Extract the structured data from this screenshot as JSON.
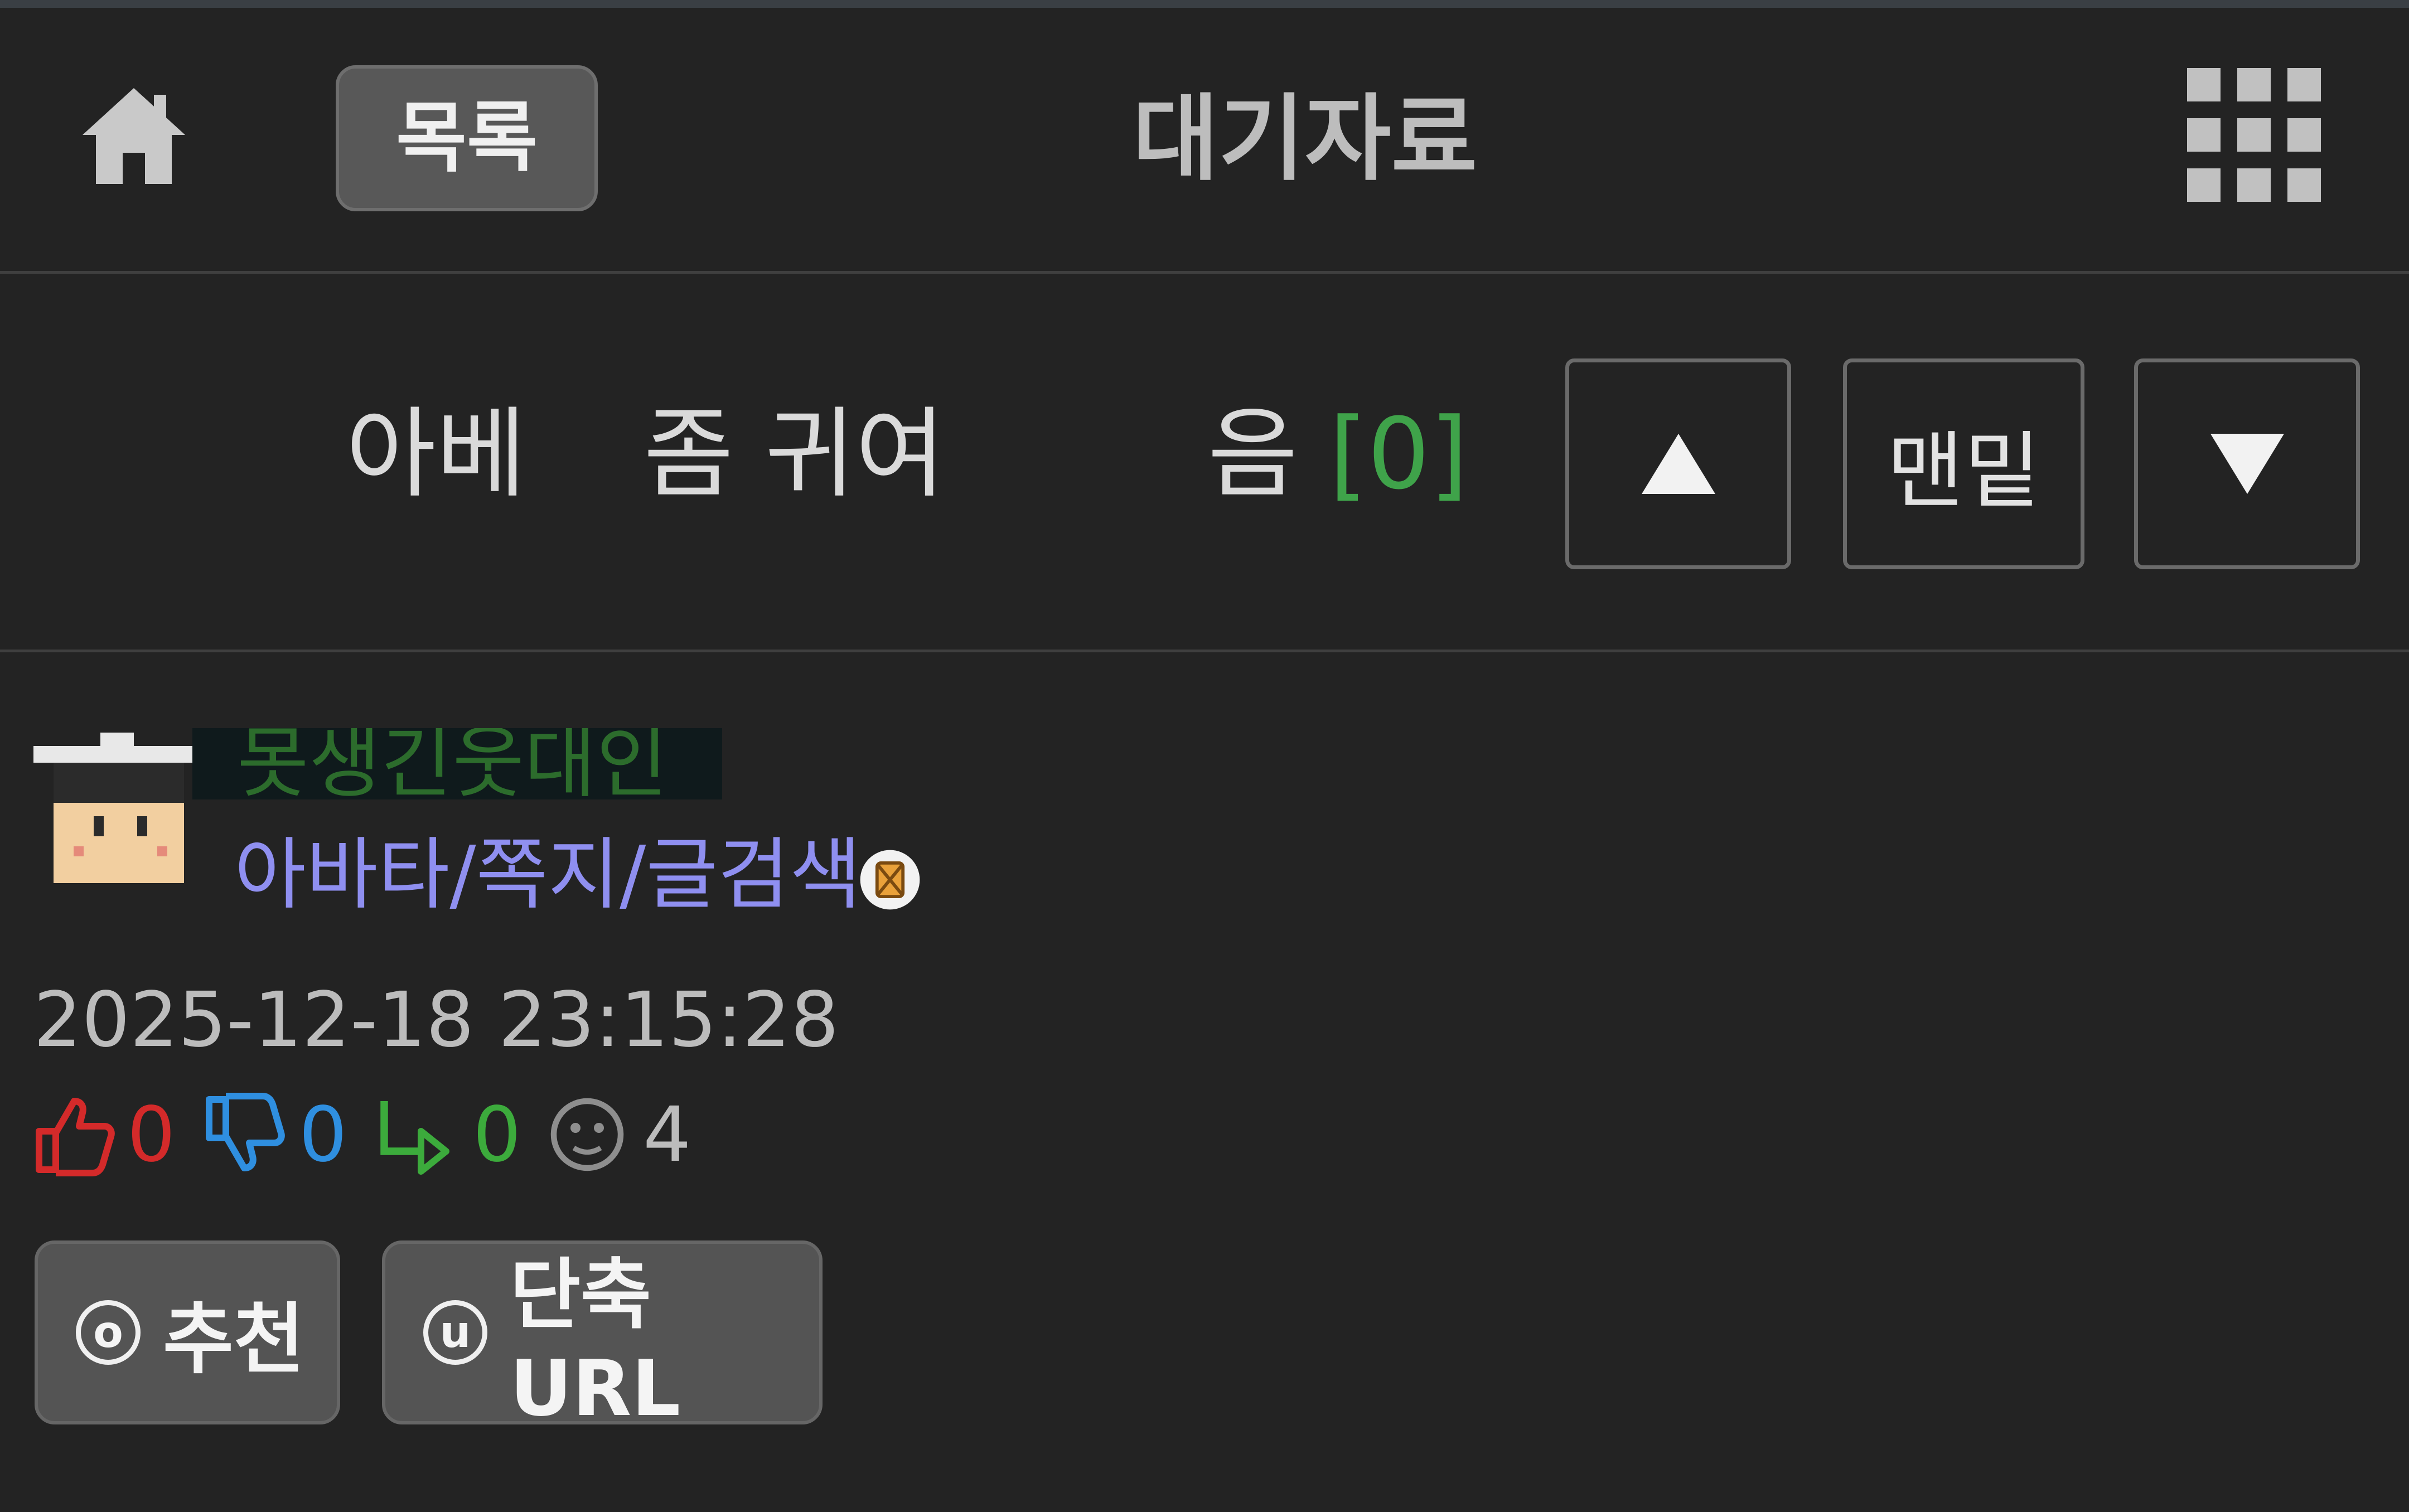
{
  "header": {
    "list_label": "목록",
    "title": "대기자료"
  },
  "post": {
    "title_part1": "아베",
    "title_part2": "좀 귀여",
    "title_part3": "음",
    "comment_count": "[0]",
    "nav_bottom_label": "맨밑"
  },
  "author": {
    "nickname": "못생긴웃대인",
    "links": "아바타/쪽지/글검색",
    "datetime": "2025-12-18 23:15:28"
  },
  "stats": {
    "upvotes": "0",
    "downvotes": "0",
    "shares": "0",
    "views": "4"
  },
  "actions": {
    "recommend_key": "o",
    "recommend_label": "추천",
    "shorturl_key": "u",
    "shorturl_label": "단축URL"
  },
  "colors": {
    "background": "#232323",
    "comment_count": "#3fa34a",
    "upvote": "#d42a2a",
    "downvote": "#2f8fe0",
    "share": "#3cab3c",
    "link": "#8f8ff0"
  },
  "icons": [
    "home-icon",
    "grid-menu-icon",
    "arrow-up-icon",
    "arrow-down-icon",
    "badge-icon",
    "thumbs-up-icon",
    "thumbs-down-icon",
    "share-arrow-icon",
    "face-icon"
  ]
}
